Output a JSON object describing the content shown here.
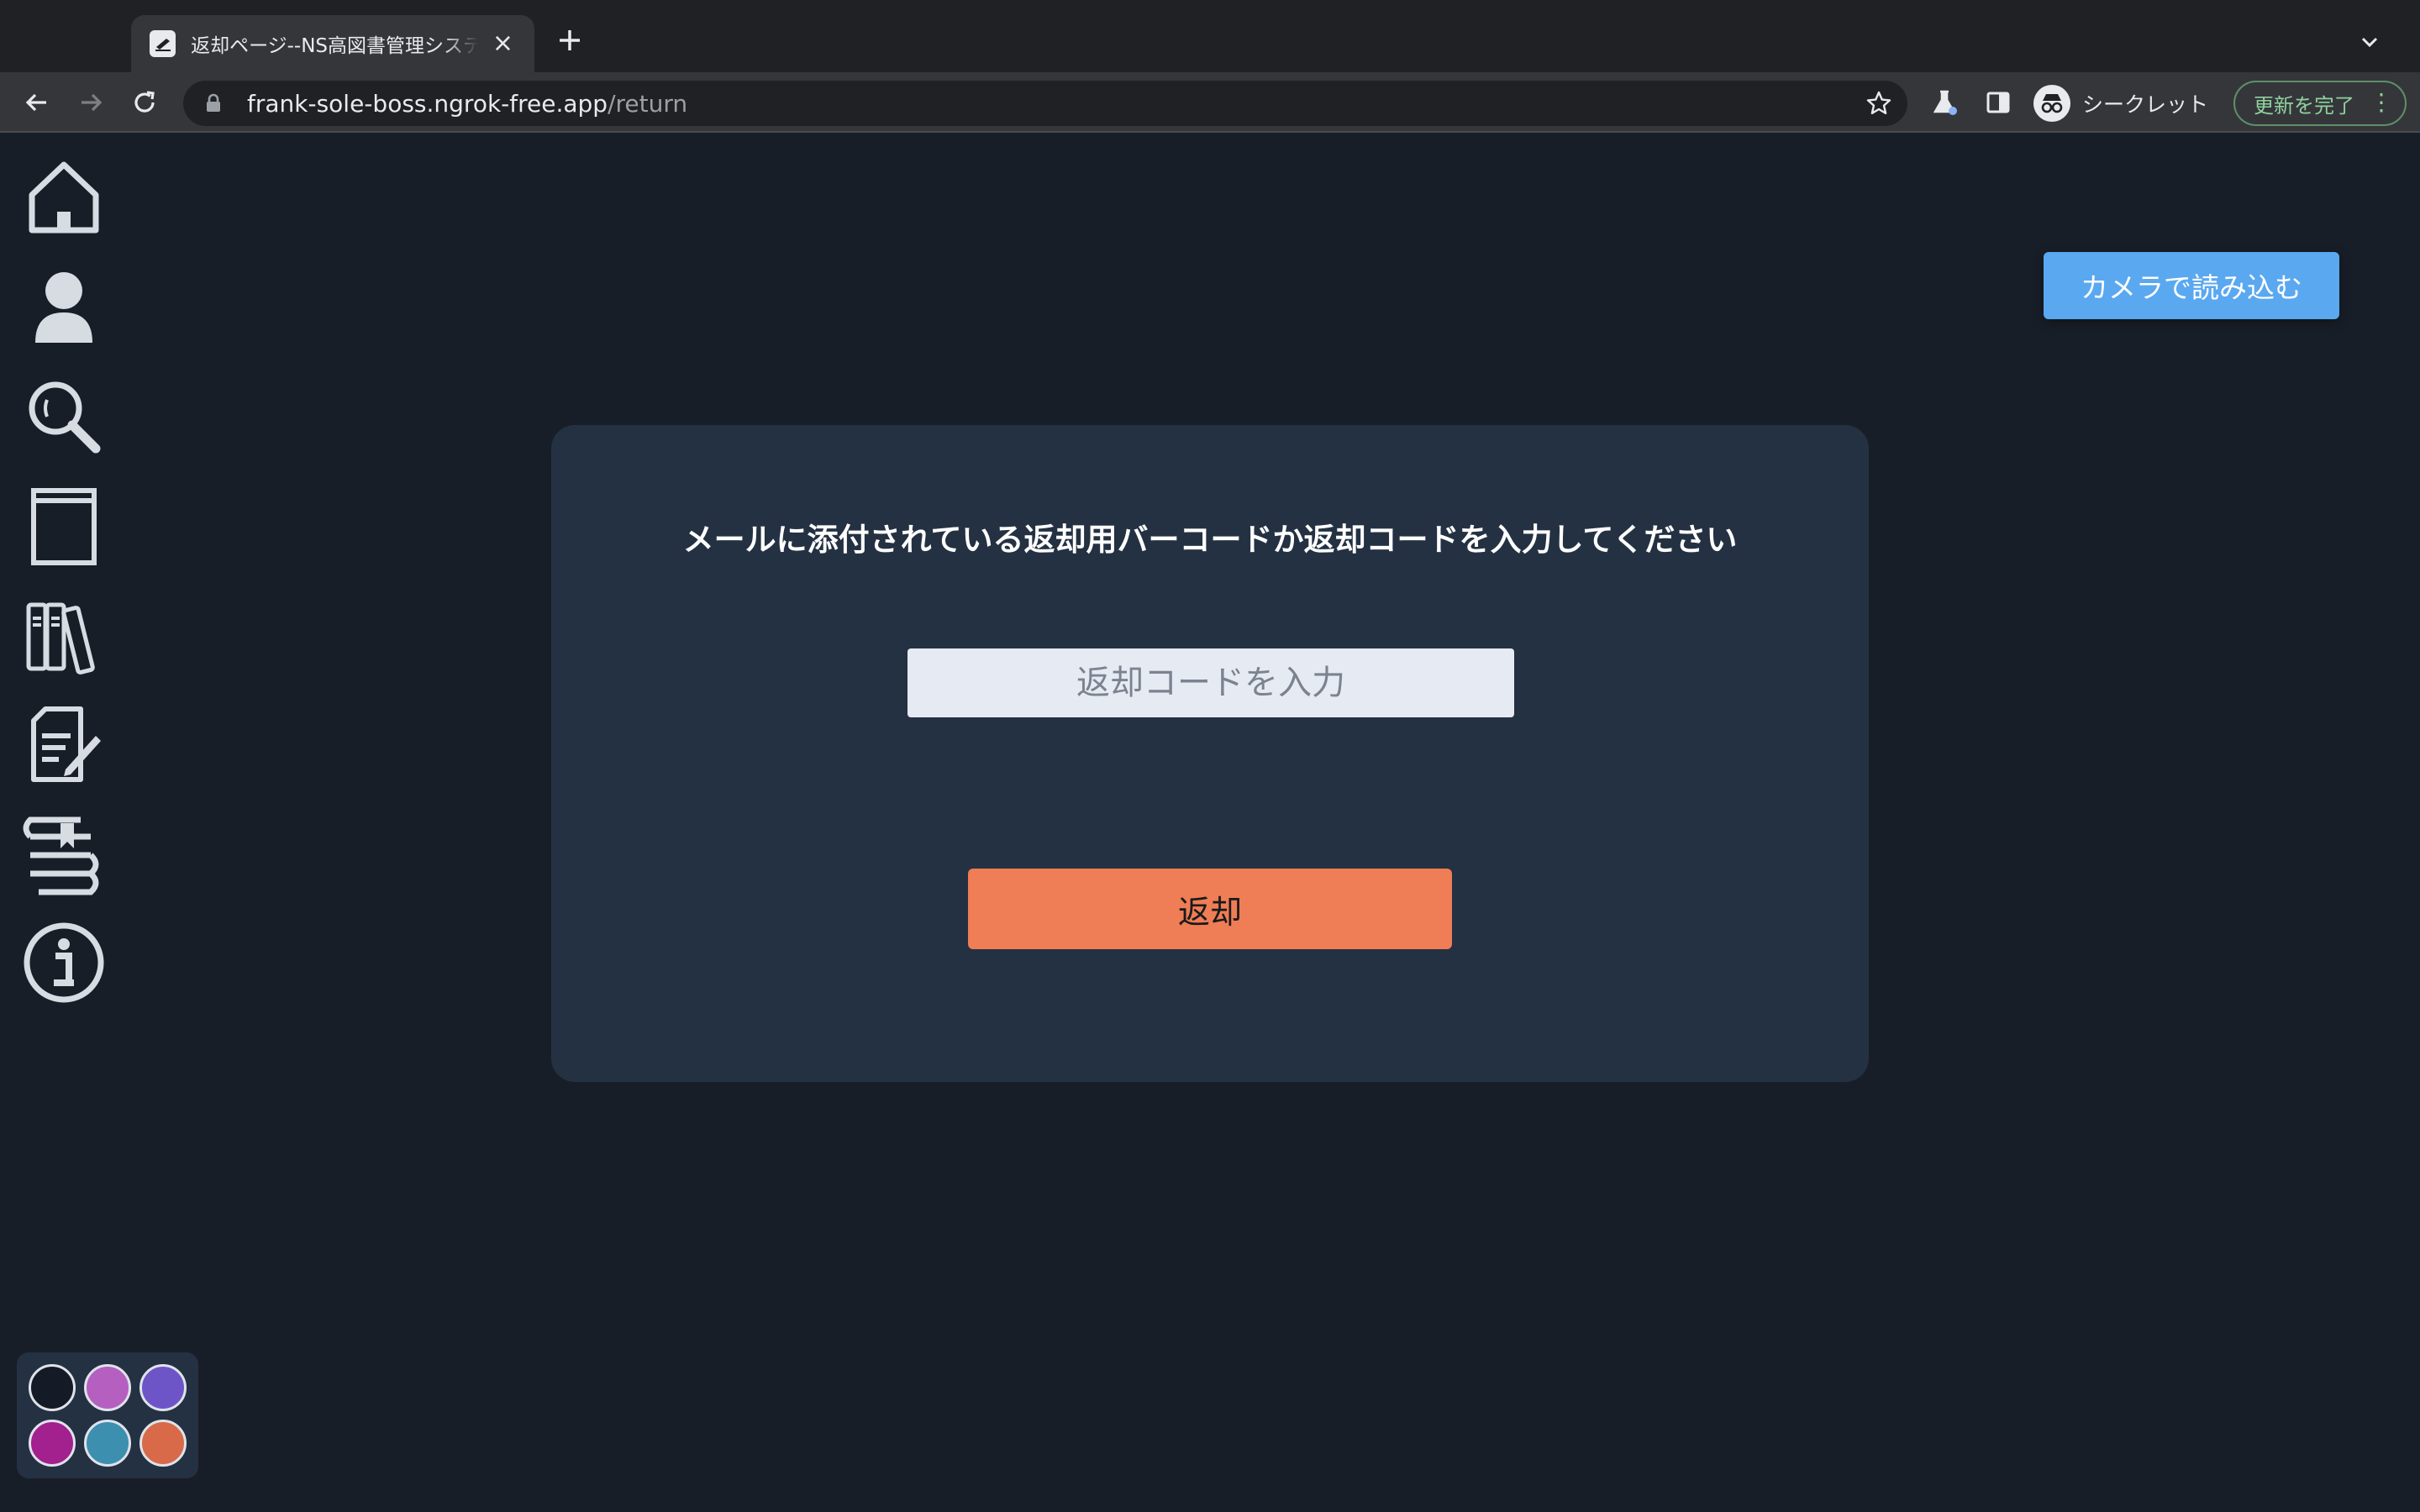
{
  "browser": {
    "tab_title": "返却ページ--NS高図書管理システム",
    "url_host": "frank-sole-boss.ngrok-free.app",
    "url_path": "/return",
    "incognito_label": "シークレット",
    "update_label": "更新を完了"
  },
  "sidebar": {
    "items": [
      {
        "icon": "home-icon"
      },
      {
        "icon": "user-icon"
      },
      {
        "icon": "search-icon"
      },
      {
        "icon": "book-icon"
      },
      {
        "icon": "library-books-icon"
      },
      {
        "icon": "edit-document-icon"
      },
      {
        "icon": "book-stack-icon"
      },
      {
        "icon": "info-icon"
      }
    ]
  },
  "page": {
    "camera_button": "カメラで読み込む",
    "instruction": "メールに添付されている返却用バーコードか返却コードを入力してください",
    "input_placeholder": "返却コードを入力",
    "input_value": "",
    "submit_button": "返却"
  },
  "theme": {
    "swatches": [
      "#151b26",
      "#b55fc0",
      "#6d55c8",
      "#a3208f",
      "#3d8fb0",
      "#d86a4a"
    ]
  },
  "colors": {
    "background": "#181e28",
    "card": "#243142",
    "accent_blue": "#5aa8f0",
    "accent_orange": "#ef7d55"
  }
}
